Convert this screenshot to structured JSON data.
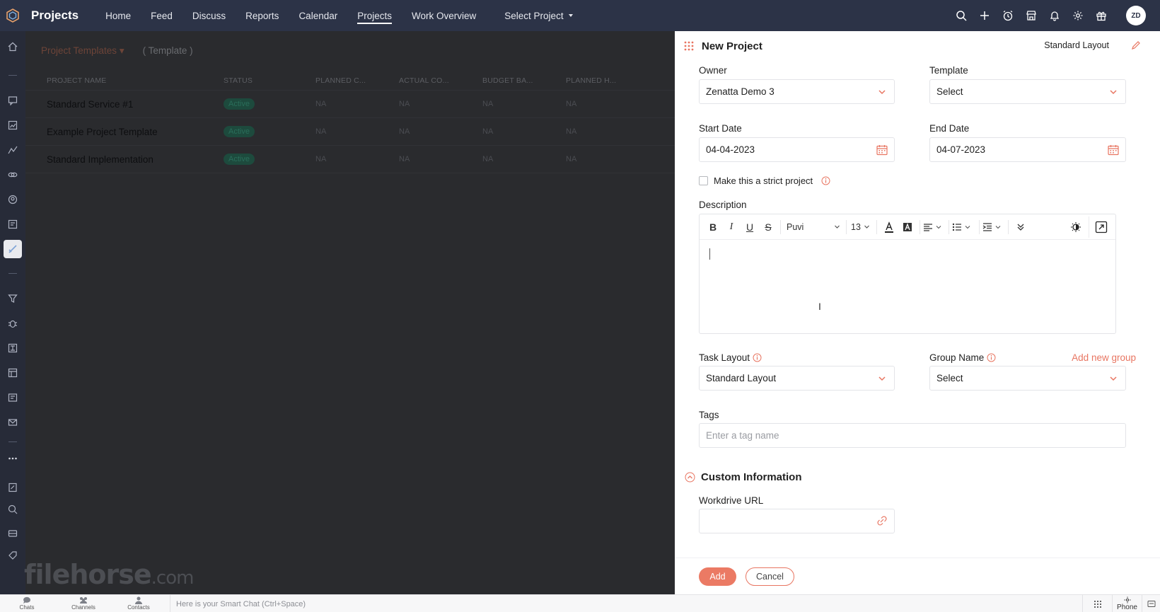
{
  "app": {
    "title": "Projects"
  },
  "nav": {
    "items": [
      "Home",
      "Feed",
      "Discuss",
      "Reports",
      "Calendar",
      "Projects",
      "Work Overview"
    ],
    "active": "Projects",
    "select_project": "Select Project"
  },
  "user": {
    "initials": "ZD"
  },
  "background": {
    "templates_dropdown": "Project Templates",
    "template_tag": "( Template )",
    "columns": [
      "PROJECT NAME",
      "STATUS",
      "PLANNED C...",
      "ACTUAL CO...",
      "BUDGET BA...",
      "PLANNED H..."
    ],
    "rows": [
      {
        "name": "Standard Service #1",
        "status": "Active",
        "planned_cost": "NA",
        "actual_cost": "NA",
        "budget": "NA",
        "planned_hours": "NA"
      },
      {
        "name": "Example Project Template",
        "status": "Active",
        "planned_cost": "NA",
        "actual_cost": "NA",
        "budget": "NA",
        "planned_hours": "NA"
      },
      {
        "name": "Standard Implementation",
        "status": "Active",
        "planned_cost": "NA",
        "actual_cost": "NA",
        "budget": "NA",
        "planned_hours": "NA"
      }
    ]
  },
  "form": {
    "title": "New Project",
    "layout_label": "Standard Layout",
    "owner": {
      "label": "Owner",
      "value": "Zenatta Demo 3"
    },
    "template": {
      "label": "Template",
      "value": "Select"
    },
    "start_date": {
      "label": "Start Date",
      "value": "04-04-2023"
    },
    "end_date": {
      "label": "End Date",
      "value": "04-07-2023"
    },
    "strict_project": {
      "label": "Make this a strict project",
      "checked": false
    },
    "description": {
      "label": "Description",
      "font": "Puvi",
      "size": "13"
    },
    "task_layout": {
      "label": "Task Layout",
      "value": "Standard Layout"
    },
    "group_name": {
      "label": "Group Name",
      "value": "Select",
      "add_link": "Add new group"
    },
    "tags": {
      "label": "Tags",
      "placeholder": "Enter a tag name"
    },
    "custom_section": {
      "title": "Custom Information"
    },
    "workdrive_url": {
      "label": "Workdrive URL",
      "value": ""
    },
    "add_label": "Add",
    "cancel_label": "Cancel"
  },
  "chatbar": {
    "tabs": [
      "Chats",
      "Channels",
      "Contacts"
    ],
    "smart_chat_placeholder": "Here is your Smart Chat (Ctrl+Space)",
    "phone_label": "Phone"
  },
  "watermark": {
    "text": "filehorse",
    "suffix": ".com"
  },
  "colors": {
    "accent": "#eb7a64",
    "topbar": "#2c3347"
  }
}
